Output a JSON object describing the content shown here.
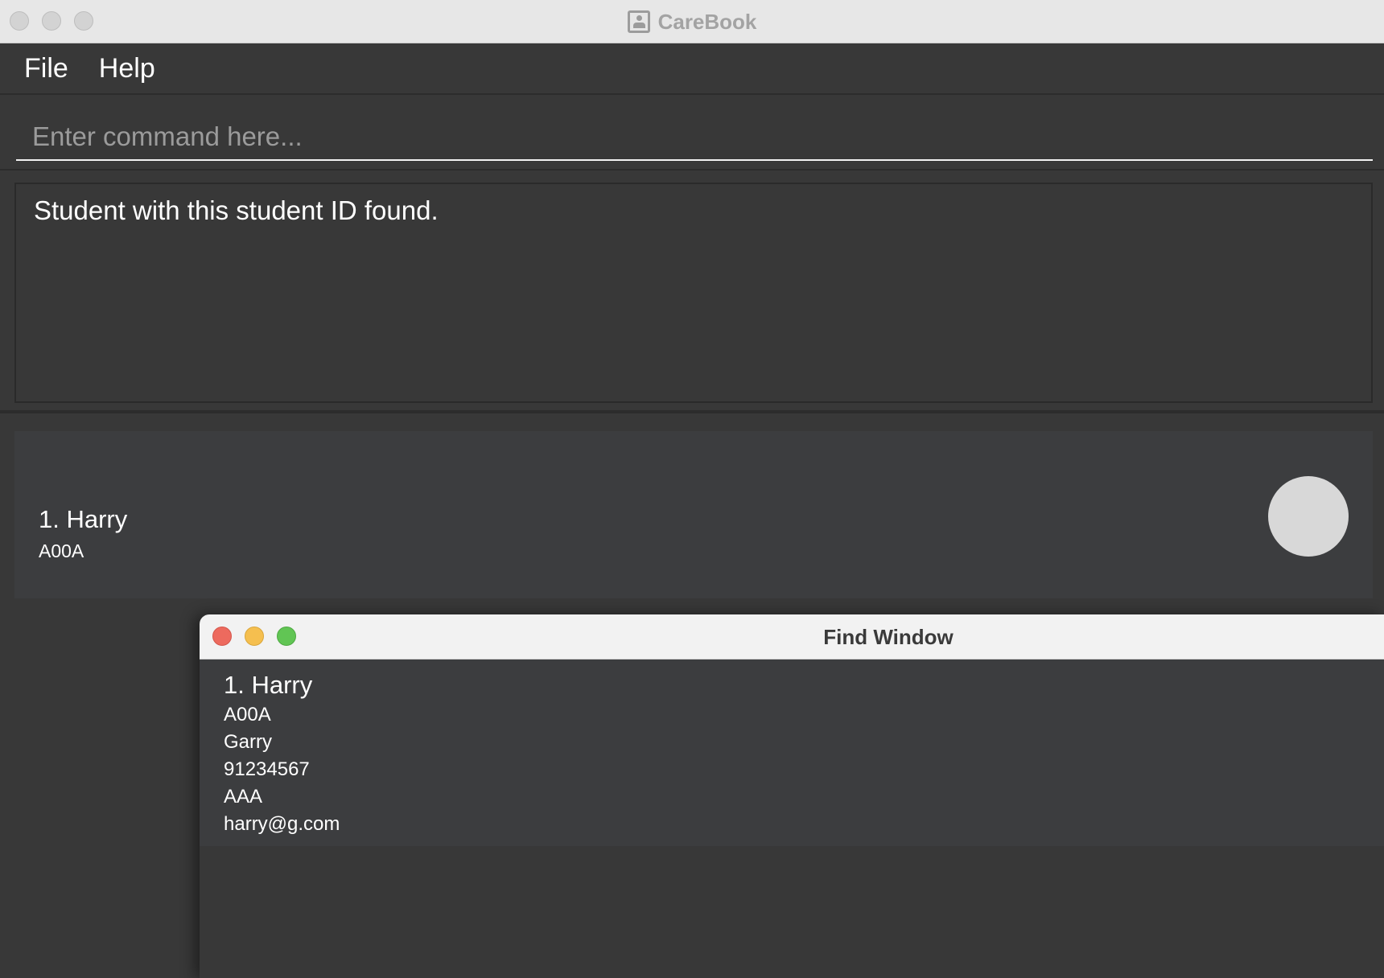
{
  "main_window": {
    "title": "CareBook",
    "menu": [
      "File",
      "Help"
    ],
    "command": {
      "value": "",
      "placeholder": "Enter command here..."
    },
    "result_message": "Student with this student ID found.",
    "students": [
      {
        "index_name": "1. Harry",
        "student_id": "A00A"
      }
    ]
  },
  "find_window": {
    "title": "Find Window",
    "result": {
      "index_name": "1. Harry",
      "lines": [
        "A00A",
        "Garry",
        "91234567",
        "AAA",
        "harry@g.com"
      ]
    }
  },
  "colors": {
    "background": "#383838",
    "card": "#3c3d3f",
    "close": "#ed6a5e",
    "minimize": "#f5bf4f",
    "zoom": "#61c554",
    "avatar": "#d8d8d8"
  }
}
